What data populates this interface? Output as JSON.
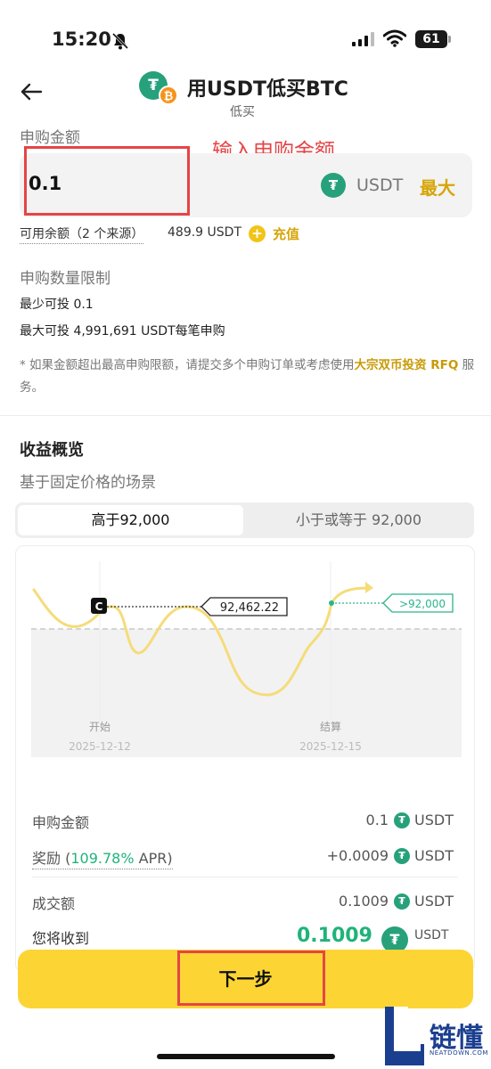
{
  "status_bar": {
    "time": "15:20",
    "battery": "61"
  },
  "header": {
    "title": "用USDT低买BTC",
    "subtitle": "低买",
    "coin_usdt_glyph": "₮",
    "coin_btc_glyph": "₿"
  },
  "subscribe": {
    "label": "申购金额",
    "annotation": "输入申购金额",
    "input_value": "0.1",
    "unit": "USDT",
    "max_label": "最大",
    "balance_label": "可用余额（2 个来源）",
    "balance_value": "489.9 USDT",
    "recharge_label": "充值"
  },
  "limits": {
    "title": "申购数量限制",
    "min_text": "最少可投 0.1",
    "max_text": "最大可投 4,991,691 USDT每笔申购",
    "note_prefix": "* 如果金额超出最高申购限额，请提交多个申购订单或考虑使用",
    "note_link": "大宗双币投资 RFQ",
    "note_suffix": " 服务。"
  },
  "yield": {
    "title": "收益概览",
    "subtitle": "基于固定价格的场景",
    "tabs": [
      {
        "label": "高于92,000",
        "active": true
      },
      {
        "label": "小于或等于 92,000",
        "active": false
      }
    ]
  },
  "chart": {
    "current_price": "92,462.22",
    "target": ">92,000",
    "marker": "C",
    "start_label": "开始",
    "start_date": "2025-12-12",
    "settle_label": "结算",
    "settle_date": "2025-12-15",
    "colors": {
      "line": "#f5dc7a",
      "target": "#2bb58a"
    }
  },
  "summary": {
    "subscribe_label": "申购金额",
    "subscribe_value": "0.1",
    "reward_label": "奖励 (",
    "reward_pct": "109.78%",
    "reward_apr": " APR)",
    "reward_value": "+0.0009",
    "deal_label": "成交额",
    "deal_value": "0.1009",
    "unit": "USDT",
    "receive_label": "您将收到",
    "receive_value": "0.1009"
  },
  "footer": {
    "next_label": "下一步"
  },
  "watermark": {
    "cn": "链懂",
    "en": "NEATDOWN.COM"
  }
}
